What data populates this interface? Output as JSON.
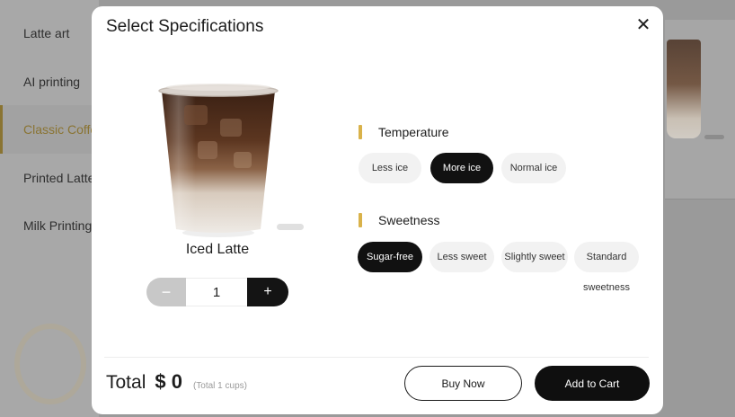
{
  "background": {
    "sidebar_items": [
      {
        "label": "Latte art",
        "active": false
      },
      {
        "label": "AI printing",
        "active": false
      },
      {
        "label": "Classic Coffee",
        "active": true
      },
      {
        "label": "Printed Latte",
        "active": false
      },
      {
        "label": "Milk Printing",
        "active": false
      }
    ]
  },
  "modal": {
    "title": "Select Specifications",
    "close_icon": "close-icon",
    "close_glyph": "✕",
    "product": {
      "name": "Iced Latte",
      "image": "iced-latte-cup-image"
    },
    "quantity": {
      "minus": "−",
      "value": "1",
      "plus": "+"
    },
    "sections": {
      "temperature": {
        "label": "Temperature",
        "options": [
          {
            "label": "Less ice",
            "selected": false
          },
          {
            "label": "More ice",
            "selected": true
          },
          {
            "label": "Normal ice",
            "selected": false
          }
        ]
      },
      "sweetness": {
        "label": "Sweetness",
        "options": [
          {
            "label": "Sugar-free",
            "selected": true
          },
          {
            "label": "Less sweet",
            "selected": false
          },
          {
            "label": "Slightly sweet",
            "selected": false
          },
          {
            "label": "Standard",
            "selected": false
          }
        ],
        "overflow_text": "sweetness"
      }
    },
    "footer": {
      "total_label": "Total",
      "total_amount": "$ 0",
      "total_cups": "(Total 1 cups)",
      "buy_now": "Buy Now",
      "add_to_cart": "Add to Cart"
    }
  },
  "colors": {
    "accent": "#d9b24a",
    "selected_bg": "#111111",
    "option_bg": "#f2f2f2",
    "overlay_bg": "#9e9e9e"
  }
}
